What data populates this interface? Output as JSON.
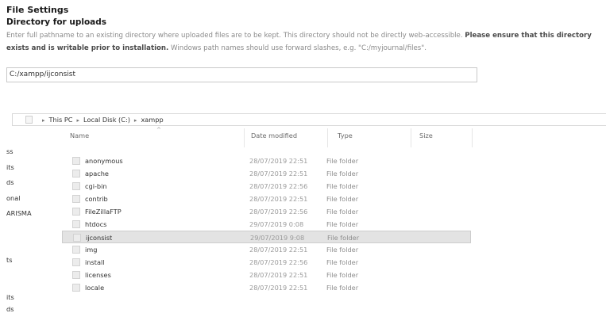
{
  "settings": {
    "title": "File Settings",
    "subtitle": "Directory for uploads",
    "desc_part1": "Enter full pathname to an existing directory where uploaded files are to be kept. This directory should not be directly web-accessible.",
    "desc_bold": "Please ensure that this directory exists and is writable prior to installation.",
    "desc_part2": "Windows path names should use forward slashes, e.g. \"C:/myjournal/files\".",
    "input_value": "C:/xampp/ijconsist"
  },
  "explorer": {
    "breadcrumb": [
      "This PC",
      "Local Disk (C:)",
      "xampp"
    ],
    "columns": {
      "name": "Name",
      "date": "Date modified",
      "type": "Type",
      "size": "Size"
    },
    "nav_items": [
      "ss",
      "its",
      "ds",
      "onal",
      "ARISMA",
      "ts",
      "its",
      "ds"
    ],
    "files": [
      {
        "name": "anonymous",
        "date": "28/07/2019 22:51",
        "type": "File folder"
      },
      {
        "name": "apache",
        "date": "28/07/2019 22:51",
        "type": "File folder"
      },
      {
        "name": "cgi-bin",
        "date": "28/07/2019 22:56",
        "type": "File folder"
      },
      {
        "name": "contrib",
        "date": "28/07/2019 22:51",
        "type": "File folder"
      },
      {
        "name": "FileZillaFTP",
        "date": "28/07/2019 22:56",
        "type": "File folder"
      },
      {
        "name": "htdocs",
        "date": "29/07/2019 0:08",
        "type": "File folder"
      },
      {
        "name": "ijconsist",
        "date": "29/07/2019 9:08",
        "type": "File folder",
        "selected": true
      },
      {
        "name": "img",
        "date": "28/07/2019 22:51",
        "type": "File folder"
      },
      {
        "name": "install",
        "date": "28/07/2019 22:56",
        "type": "File folder"
      },
      {
        "name": "licenses",
        "date": "28/07/2019 22:51",
        "type": "File folder"
      },
      {
        "name": "locale",
        "date": "28/07/2019 22:51",
        "type": "File folder"
      }
    ]
  }
}
